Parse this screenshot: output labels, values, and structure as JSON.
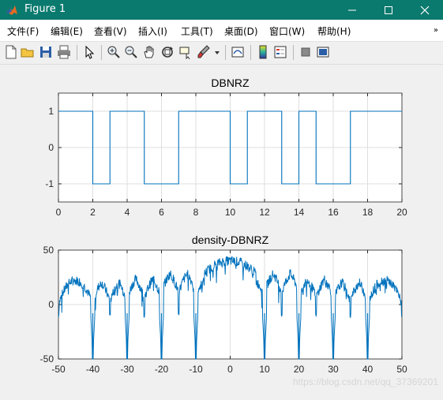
{
  "window": {
    "title": "Figure 1",
    "controls": [
      "minimize",
      "maximize",
      "close"
    ]
  },
  "menubar": {
    "items": [
      "文件(F)",
      "编辑(E)",
      "查看(V)",
      "插入(I)",
      "工具(T)",
      "桌面(D)",
      "窗口(W)",
      "帮助(H)"
    ],
    "overflow": "»"
  },
  "toolbar": {
    "buttons": [
      "new-figure-icon",
      "open-file-icon",
      "save-icon",
      "print-icon",
      "pointer-icon",
      "zoom-in-icon",
      "zoom-out-icon",
      "pan-hand-icon",
      "rotate-3d-icon",
      "data-cursor-icon",
      "brush-icon",
      "brush-dropdown-icon",
      "link-plot-icon",
      "colorbar-icon",
      "legend-icon",
      "hide-plot-tools-icon",
      "show-plot-tools-icon"
    ]
  },
  "chart_data": [
    {
      "type": "line",
      "title": "DBNRZ",
      "xlabel": "",
      "ylabel": "",
      "xlim": [
        0,
        20
      ],
      "ylim": [
        -1.5,
        1.5
      ],
      "xticks": [
        0,
        2,
        4,
        6,
        8,
        10,
        12,
        14,
        16,
        18,
        20
      ],
      "yticks": [
        -1,
        0,
        1
      ],
      "grid": true,
      "color": "#0072bd",
      "step": true,
      "x": [
        0,
        2,
        3,
        5,
        7,
        10,
        11,
        13,
        14,
        15,
        17,
        20
      ],
      "y": [
        1,
        -1,
        1,
        -1,
        1,
        -1,
        1,
        -1,
        1,
        -1,
        1,
        1
      ]
    },
    {
      "type": "line",
      "title": "density-DBNRZ",
      "xlabel": "",
      "ylabel": "",
      "xlim": [
        -50,
        50
      ],
      "ylim": [
        -50,
        50
      ],
      "xticks": [
        -50,
        -40,
        -30,
        -20,
        -10,
        0,
        10,
        20,
        30,
        40,
        50
      ],
      "yticks": [
        -50,
        0,
        50
      ],
      "grid": true,
      "color": "#0072bd",
      "deep_nulls_x": [
        -40,
        -30,
        -20,
        -10,
        10,
        20,
        30,
        40
      ],
      "shallow_nulls_x": [
        -50,
        -35,
        -25,
        -15,
        15,
        25,
        35,
        50
      ],
      "lobe_peaks": [
        {
          "x": -45,
          "y": 22
        },
        {
          "x": -35,
          "y": 25
        },
        {
          "x": -25,
          "y": 28
        },
        {
          "x": -15,
          "y": 33
        },
        {
          "x": 0,
          "y": 40
        },
        {
          "x": 15,
          "y": 33
        },
        {
          "x": 25,
          "y": 28
        },
        {
          "x": 35,
          "y": 25
        },
        {
          "x": 45,
          "y": 22
        }
      ]
    }
  ],
  "watermark": "https://blog.csdn.net/qq_37369201"
}
